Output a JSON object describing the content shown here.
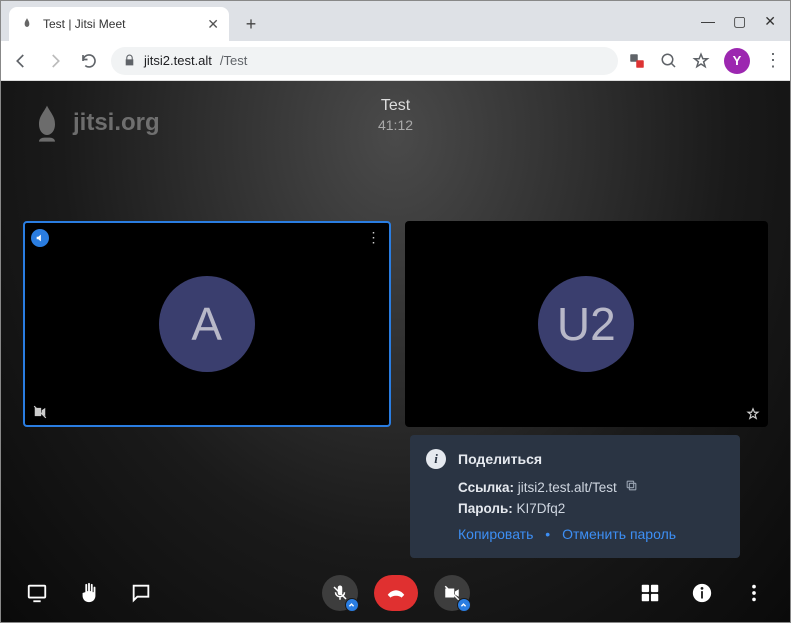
{
  "browser": {
    "tab_title": "Test | Jitsi Meet",
    "url_host": "jitsi2.test.alt",
    "url_path": "/Test",
    "profile_initial": "Y"
  },
  "jitsi": {
    "watermark": "jitsi.org",
    "conference_name": "Test",
    "elapsed_time": "41:12"
  },
  "participants": [
    {
      "initial": "A",
      "active": true
    },
    {
      "initial": "U2",
      "active": false
    }
  ],
  "share": {
    "title": "Поделиться",
    "link_label": "Ссылка:",
    "link_value": "jitsi2.test.alt/Test",
    "password_label": "Пароль:",
    "password_value": "KI7Dfq2",
    "copy_action": "Копировать",
    "cancel_password_action": "Отменить пароль"
  }
}
